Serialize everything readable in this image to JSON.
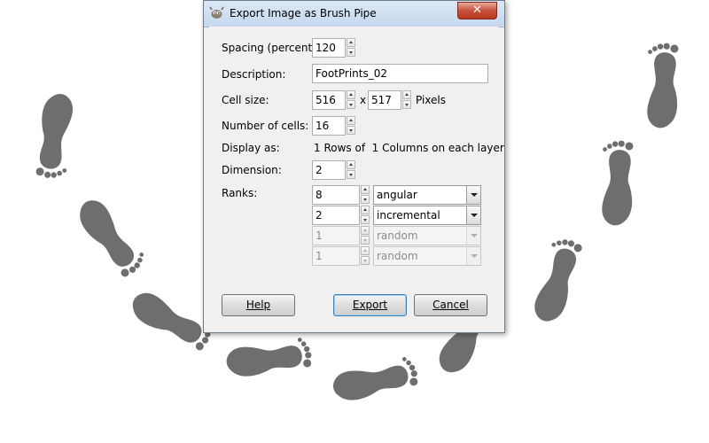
{
  "window": {
    "title": "Export Image as Brush Pipe",
    "close_symbol": "✕"
  },
  "fields": {
    "spacing": {
      "label": "Spacing (percent):",
      "value": "120"
    },
    "description": {
      "label": "Description:",
      "value": "FootPrints_02"
    },
    "cell_size": {
      "label": "Cell size:",
      "width": "516",
      "separator": "x",
      "height": "517",
      "unit": "Pixels"
    },
    "number_of_cells": {
      "label": "Number of cells:",
      "value": "16"
    },
    "display_as": {
      "label": "Display as:",
      "value": "1 Rows of  1 Columns on each layer"
    },
    "dimension": {
      "label": "Dimension:",
      "value": "2"
    },
    "ranks": {
      "label": "Ranks:",
      "rows": [
        {
          "value": "8",
          "mode": "angular"
        },
        {
          "value": "2",
          "mode": "incremental"
        },
        {
          "value": "1",
          "mode": "random"
        },
        {
          "value": "1",
          "mode": "random"
        }
      ]
    }
  },
  "buttons": {
    "help": "Help",
    "export": "Export",
    "cancel": "Cancel"
  },
  "colors": {
    "footprint": "#6e6e6e",
    "dialog_bg": "#f0f0f0",
    "titlebar": "#c5d8ee"
  },
  "background": {
    "icon": "footprints"
  }
}
